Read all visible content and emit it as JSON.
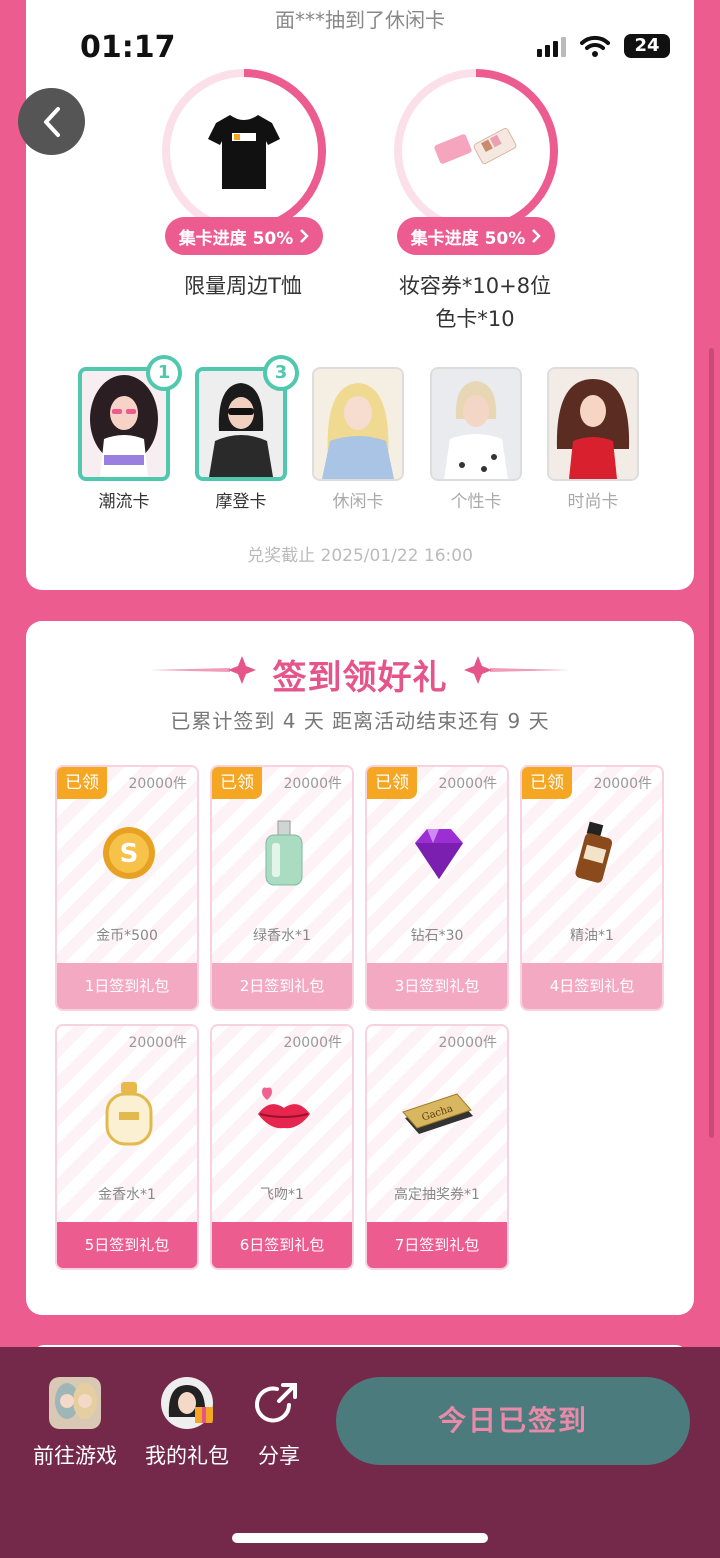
{
  "status": {
    "time": "01:17",
    "battery": "24"
  },
  "ticker": "面***抽到了休闲卡",
  "prizes": [
    {
      "label": "限量周边T恤",
      "progress": "集卡进度 50%",
      "progress_value": 0.5
    },
    {
      "label": "妆容券*10+8位色卡*10",
      "label_line1": "妆容券*10+8位",
      "label_line2": "色卡*10",
      "progress": "集卡进度 50%",
      "progress_value": 0.5
    }
  ],
  "cards": [
    {
      "name": "潮流卡",
      "count": "1",
      "owned": true
    },
    {
      "name": "摩登卡",
      "count": "3",
      "owned": true
    },
    {
      "name": "休闲卡",
      "owned": false
    },
    {
      "name": "个性卡",
      "owned": false
    },
    {
      "name": "时尚卡",
      "owned": false
    }
  ],
  "deadline": "兑奖截止 2025/01/22 16:00",
  "sign": {
    "title": "签到领好礼",
    "subtitle": "已累计签到 4 天  距离活动结束还有 9 天",
    "claimed_label": "已领",
    "gifts": [
      {
        "stock": "20000件",
        "name": "金币*500",
        "day": "1日签到礼包",
        "claimed": true,
        "icon": "coin-icon"
      },
      {
        "stock": "20000件",
        "name": "绿香水*1",
        "day": "2日签到礼包",
        "claimed": true,
        "icon": "green-perfume-icon"
      },
      {
        "stock": "20000件",
        "name": "钻石*30",
        "day": "3日签到礼包",
        "claimed": true,
        "icon": "diamond-icon"
      },
      {
        "stock": "20000件",
        "name": "精油*1",
        "day": "4日签到礼包",
        "claimed": true,
        "icon": "essential-oil-icon"
      },
      {
        "stock": "20000件",
        "name": "金香水*1",
        "day": "5日签到礼包",
        "claimed": false,
        "icon": "gold-perfume-icon"
      },
      {
        "stock": "20000件",
        "name": "飞吻*1",
        "day": "6日签到礼包",
        "claimed": false,
        "icon": "kiss-icon"
      },
      {
        "stock": "20000件",
        "name": "高定抽奖券*1",
        "day": "7日签到礼包",
        "claimed": false,
        "icon": "gacha-ticket-icon",
        "ticket_text": "Gacha"
      }
    ]
  },
  "bottom": {
    "goto_game": "前往游戏",
    "my_gifts": "我的礼包",
    "share": "分享",
    "signed_today": "今日已签到"
  },
  "colors": {
    "brand_pink": "#ec5c8f",
    "teal": "#4fc8ad",
    "bottom_bg": "#75294a",
    "button_teal": "#4b7b7d"
  }
}
